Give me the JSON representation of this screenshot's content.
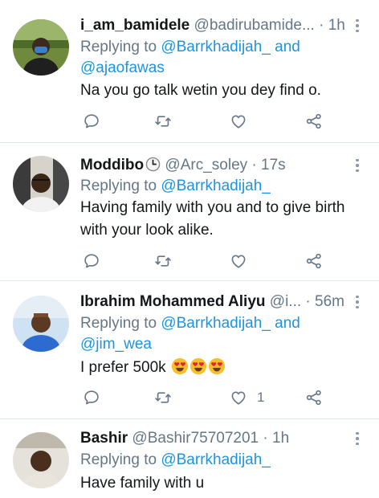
{
  "tweets": [
    {
      "name": "i_am_bamidele",
      "handle": "@badirubamide...",
      "dot": "·",
      "time": "1h",
      "replying_prefix": "Replying to",
      "mention_line1": "@Barrkhadijah_ and",
      "mention_line2": "@ajaofawas",
      "text": "Na you go talk wetin you dey find o.",
      "like_count": ""
    },
    {
      "name": "Moddibo",
      "handle": "@Arc_soley",
      "dot": "·",
      "time": "17s",
      "replying_prefix": "Replying to",
      "mention_line1": "@Barrkhadijah_",
      "text_line1": "Having family with you and to give birth",
      "text_line2": "with your look alike.",
      "like_count": ""
    },
    {
      "name": "Ibrahim Mohammed Aliyu",
      "handle": "@i...",
      "dot": "·",
      "time": "56m",
      "replying_prefix": "Replying to",
      "mention_line1": "@Barrkhadijah_ and",
      "mention_line2": "@jim_wea",
      "text": "I prefer 500k",
      "like_count": "1"
    },
    {
      "name": "Bashir",
      "handle": "@Bashir75707201",
      "dot": "·",
      "time": "1h",
      "replying_prefix": "Replying to",
      "mention_line1": "@Barrkhadijah_",
      "text": "Have family with u"
    }
  ],
  "icons": {
    "reply": "reply-icon",
    "retweet": "retweet-icon",
    "like": "heart-icon",
    "share": "share-icon",
    "more": "more-vertical-icon",
    "clock": "clock-icon",
    "emoji": "heart-eyes-emoji"
  },
  "colors": {
    "link": "#1b95e0",
    "muted": "#657786",
    "text": "#14171a",
    "divider": "#e1e8ed"
  }
}
